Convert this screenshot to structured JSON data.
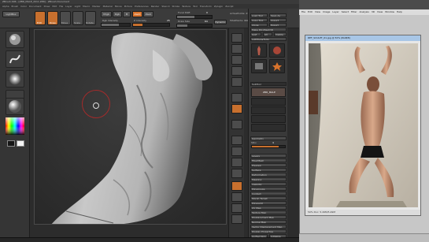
{
  "zbrush": {
    "title": "ZBrush 4R6 - [ZBR_MALE_2011.ZPR] - ZBrush Document",
    "menus": [
      "Alpha",
      "Brush",
      "Color",
      "Document",
      "Draw",
      "Edit",
      "File",
      "Layer",
      "Light",
      "Macro",
      "Marker",
      "Material",
      "Movie",
      "Picture",
      "Preferences",
      "Render",
      "Stencil",
      "Stroke",
      "Texture",
      "Tool",
      "Transform",
      "Zplugin",
      "Zscript"
    ],
    "toolbar": {
      "lightbox_label": "LightBox",
      "edit_label": "Edit",
      "draw_label": "Draw",
      "move_label": "Move",
      "scale_label": "Scale",
      "rotate_label": "Rotate",
      "mrgb_label": "Mrgb",
      "rgb_label": "Rgb",
      "m_label": "M",
      "zadd_label": "Zadd",
      "zsub_label": "Zsub",
      "focal_shift_label": "Focal Shift",
      "focal_shift_value": "0",
      "draw_size_label": "Draw Size",
      "draw_size_value": "64",
      "dynamic_label": "Dynamic",
      "rgb_intensity_label": "Rgb Intensity",
      "z_intensity_label": "Z Intensity",
      "z_intensity_value": "25",
      "active_points_label": "ActivePoints: 274,572",
      "total_points_label": "TotalPoints: 960,490"
    },
    "tool_palette": {
      "load_tool": "Load Tool",
      "save_as": "Save As",
      "copy_tool": "Copy Tool",
      "import": "Import",
      "export": "Export",
      "clone": "Clone",
      "make_polymesh": "Make PolyMesh3D",
      "goz": "GoZ",
      "all": "All",
      "visible": "Visible",
      "lightbox_tools": "Lightbox▸Tools",
      "subtool": "SubTool",
      "geometry": "Geometry",
      "layers": "Layers",
      "fibermesh": "FiberMesh",
      "preview": "Preview",
      "surface": "Surface",
      "deformation": "Deformation",
      "masking": "Masking",
      "visibility": "Visibility",
      "polygroups": "Polygroups",
      "contact": "Contact",
      "morph_target": "Morph Target",
      "polypaint": "Polypaint",
      "uv_map": "UV Map",
      "texture_map": "Texture Map",
      "displacement_map": "Displacement Map",
      "normal_map": "Normal Map",
      "vector_displacement": "Vector Displacement Map",
      "display_properties": "Display Properties",
      "unified_skin": "Unified Skin",
      "initialize": "Initialize",
      "import2": "Import",
      "export2": "Export",
      "subtool_name": "ZBR_MALE",
      "sdiv_label": "SDiv",
      "sdiv_value": "4"
    }
  },
  "viewer": {
    "menus": [
      "File",
      "Edit",
      "View",
      "Image",
      "Layer",
      "Select",
      "Filter",
      "Analysis",
      "3D",
      "View",
      "Window",
      "Help"
    ],
    "doc_title": "REF_SCULPT_01.jpg @ 50% (RGB/8)",
    "status_text": "50%   Doc: 5.49M/5.49M"
  },
  "colors": {
    "zbrush_orange": "#d8732c",
    "zbrush_dark": "#2c2c2c"
  }
}
